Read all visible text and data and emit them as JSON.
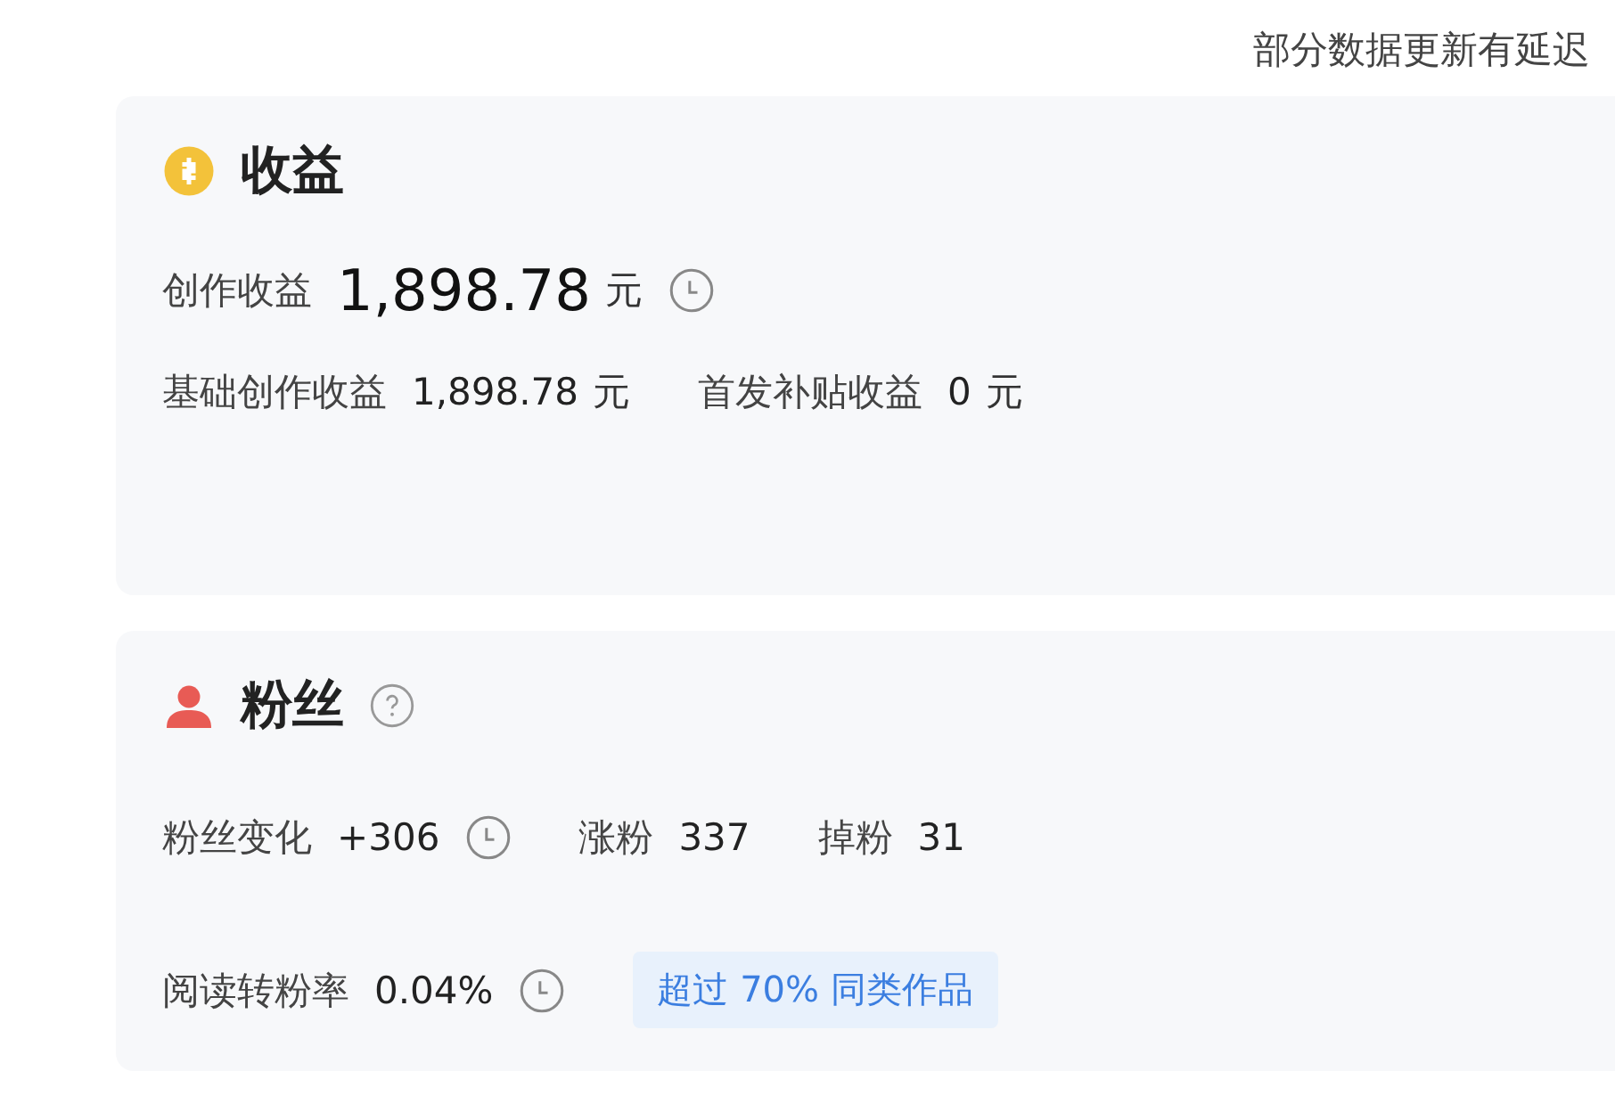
{
  "notice": "部分数据更新有延迟",
  "sections": [
    {
      "kind": "earnings",
      "title": "收益",
      "help": false,
      "rows": [
        {
          "items": [
            {
              "label": "创作收益",
              "value": "1,898.78",
              "unit": "元",
              "kind": "headline",
              "clock": true
            }
          ]
        },
        {
          "items": [
            {
              "label": "基础创作收益",
              "value": "1,898.78",
              "unit": "元",
              "kind": "metric",
              "clock": false
            },
            {
              "label": "首发补贴收益",
              "value": "0",
              "unit": "元",
              "kind": "metric",
              "clock": false
            }
          ]
        }
      ]
    },
    {
      "kind": "fans",
      "title": "粉丝",
      "help": true,
      "rows": [
        {
          "items": [
            {
              "label": "粉丝变化",
              "value": "+306",
              "kind": "metric",
              "clock": true
            },
            {
              "label": "涨粉",
              "value": "337",
              "kind": "metric",
              "clock": false
            },
            {
              "label": "掉粉",
              "value": "31",
              "kind": "metric",
              "clock": false
            }
          ]
        },
        {
          "items": [
            {
              "label": "阅读转粉率",
              "value": "0.04%",
              "kind": "metric",
              "clock": true
            }
          ],
          "badge": "超过 70% 同类作品"
        }
      ]
    }
  ]
}
